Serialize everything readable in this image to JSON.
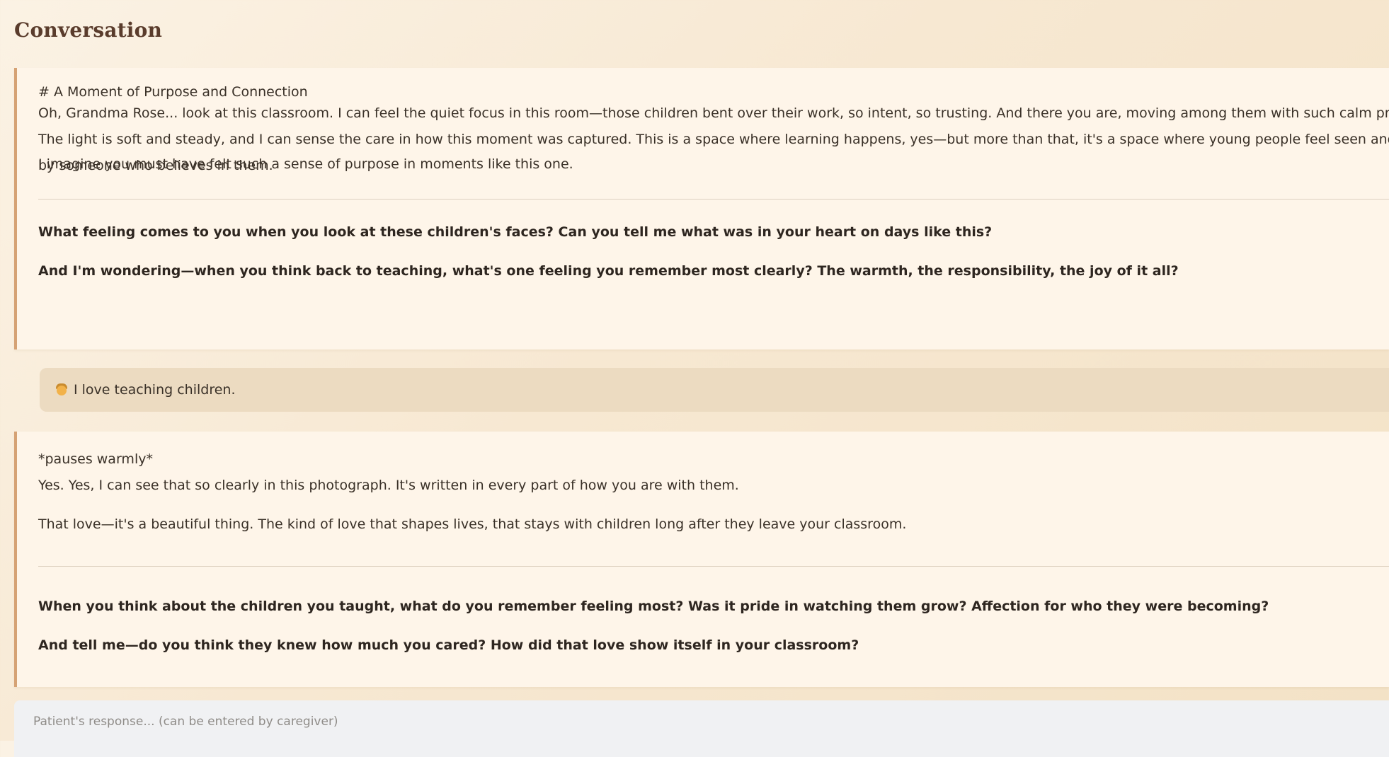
{
  "heading": "Conversation",
  "messages": [
    {
      "role": "assistant",
      "title_line": "# A Moment of Purpose and Connection",
      "paragraph_1": "Oh, Grandma Rose... look at this classroom. I can feel the quiet focus in this room—those children bent over their work, so intent, so trusting. And there you are, moving among them with such calm presence. The light is soft and steady, and I can sense the care in how this moment was captured. This is a space where learning happens, yes—but more than that, it's a space where young people feel seen and guided by someone who believes in them.",
      "paragraph_2": "I imagine you must have felt such a sense of purpose in moments like this one.",
      "question_1": "What feeling comes to you when you look at these children's faces? Can you tell me what was in your heart on days like this?",
      "question_2": "And I'm wondering—when you think back to teaching, what's one feeling you remember most clearly? The warmth, the responsibility, the joy of it all?"
    },
    {
      "role": "user",
      "icon": "person-icon",
      "text": "I love teaching children."
    },
    {
      "role": "assistant",
      "title_line": "*pauses warmly*",
      "paragraph_1": "Yes. Yes, I can see that so clearly in this photograph. It's written in every part of how you are with them.",
      "paragraph_2": "That love—it's a beautiful thing. The kind of love that shapes lives, that stays with children long after they leave your classroom.",
      "question_1": "When you think about the children you taught, what do you remember feeling most? Was it pride in watching them grow? Affection for who they were becoming?",
      "question_2": "And tell me—do you think they knew how much you cared? How did that love show itself in your classroom?"
    }
  ],
  "input": {
    "placeholder": "Patient's response... (can be entered by caregiver)",
    "value": ""
  },
  "colors": {
    "accent_border": "#d5a274",
    "card_background": "#fef5e9",
    "user_bubble": "#ecdbc1",
    "heading": "#5a3c2c",
    "input_background": "#f0f1f3"
  }
}
